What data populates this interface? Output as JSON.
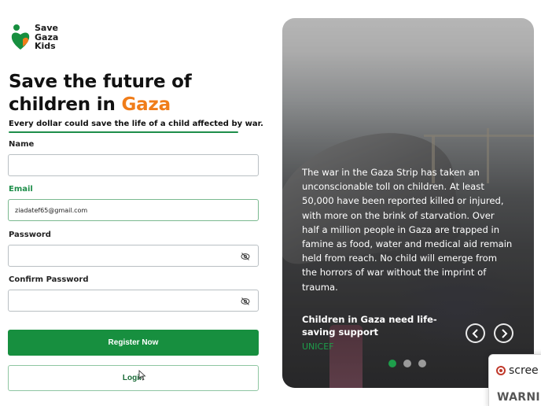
{
  "brand": {
    "name_line1": "Save",
    "name_line2": "Gaza",
    "name_line3": "Kids",
    "logo_icon": "heart-person-icon",
    "green": "#1e8e4a",
    "orange": "#f07d1a"
  },
  "hero": {
    "title_line1": "Save the future of",
    "title_line2_prefix": "children in ",
    "title_line2_accent": "Gaza",
    "subtitle": "Every dollar could save the life of a child affected by war."
  },
  "form": {
    "name_label": "Name",
    "name_value": "",
    "email_label": "Email",
    "email_value": "ziadatef65@gmail.com",
    "password_label": "Password",
    "password_value": "",
    "confirm_label": "Confirm Password",
    "confirm_value": "",
    "eye_icon": "eye-off-icon",
    "register_label": "Register Now",
    "login_label": "Login"
  },
  "carousel": {
    "text": "The war in the Gaza Strip has taken an unconscionable toll on children. At least 50,000 have been reported killed or injured, with more on the brink of starvation. Over half a million people in Gaza are trapped in famine as food, water and medical aid remain held from reach. No child will emerge from the horrors of war without the imprint of trauma.",
    "caption_title": "Children in Gaza need life-saving support",
    "caption_source": "UNICEF",
    "prev_icon": "chevron-left-icon",
    "next_icon": "chevron-right-icon",
    "dots": [
      {
        "active": true
      },
      {
        "active": false
      },
      {
        "active": false
      }
    ]
  },
  "popup": {
    "title": "scree",
    "warning": "WARNIN",
    "icon": "record-icon"
  }
}
